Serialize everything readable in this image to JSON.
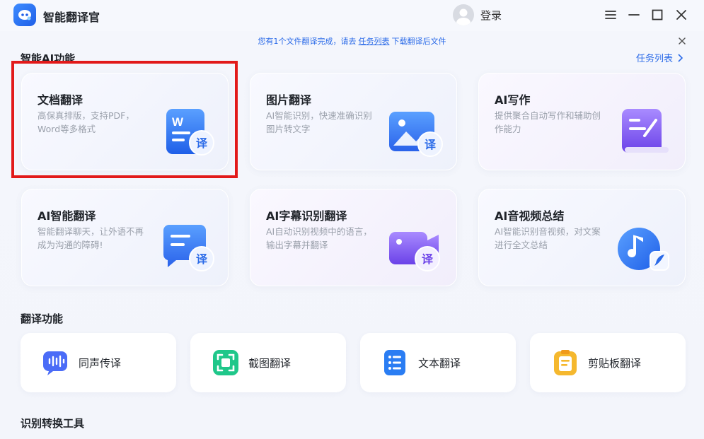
{
  "app": {
    "title": "智能翻译官",
    "login_label": "登录"
  },
  "notice": {
    "before": "您有1个文件翻译完成，请去",
    "link": "任务列表",
    "after": "下载翻译后文件"
  },
  "ai_section": {
    "title": "智能AI功能",
    "task_list_label": "任务列表",
    "cards": [
      {
        "title": "文档翻译",
        "desc": "高保真排版，支持PDF，Word等多格式",
        "icon": "word-translate-icon",
        "badge": "译",
        "icon_letter": "W"
      },
      {
        "title": "图片翻译",
        "desc": "AI智能识别，快速准确识别图片转文字",
        "icon": "image-translate-icon",
        "badge": "译"
      },
      {
        "title": "AI写作",
        "desc": "提供聚合自动写作和辅助创作能力",
        "icon": "ai-writing-icon"
      },
      {
        "title": "AI智能翻译",
        "desc": "智能翻译聊天，让外语不再成为沟通的障碍!",
        "icon": "chat-translate-icon",
        "badge": "译"
      },
      {
        "title": "AI字幕识别翻译",
        "desc": "AI自动识别视频中的语言，输出字幕并翻译",
        "icon": "subtitle-translate-icon",
        "badge": "译"
      },
      {
        "title": "AI音视频总结",
        "desc": "AI智能识别音视频，对文案进行全文总结",
        "icon": "music-summary-icon"
      }
    ]
  },
  "translate_section": {
    "title": "翻译功能",
    "tools": [
      {
        "label": "同声传译",
        "icon": "voice-wave-icon",
        "color": "#4b6cf7"
      },
      {
        "label": "截图翻译",
        "icon": "screenshot-scan-icon",
        "color": "#1fc78a"
      },
      {
        "label": "文本翻译",
        "icon": "text-list-icon",
        "color": "#2a7df3"
      },
      {
        "label": "剪贴板翻译",
        "icon": "clipboard-icon",
        "color": "#f5b82e"
      }
    ]
  },
  "convert_section": {
    "title": "识别转换工具"
  },
  "colors": {
    "accent": "#2a6ae8",
    "highlight_border": "#e21a1a"
  }
}
